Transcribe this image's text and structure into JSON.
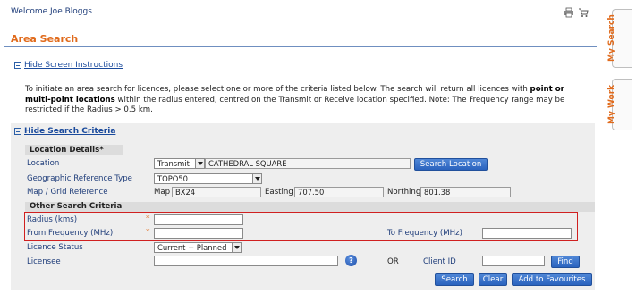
{
  "header": {
    "welcome": "Welcome Joe Bloggs",
    "page_title": "Area Search",
    "icons": [
      "print-icon",
      "shopping-cart-icon"
    ]
  },
  "instructions": {
    "toggle_label": "Hide Screen Instructions",
    "text_1": "To initiate an area search for licences, please select one or more of the criteria listed below. The search will return all licences with ",
    "bold_1": "point or",
    "bold_2": "multi-point locations",
    "text_2": " within the radius entered, centred on the Transmit or Receive location specified. Note: The Frequency range may be restricted if the Radius > 0.5 km."
  },
  "criteria": {
    "toggle_label": "Hide Search Criteria",
    "location_details": {
      "heading": "Location Details",
      "required_mark": "*",
      "location_label": "Location",
      "location_type": "Transmit",
      "location_value": "CATHEDRAL SQUARE",
      "search_location_button": "Search Location",
      "geo_ref_label": "Geographic Reference Type",
      "geo_ref_value": "TOPO50",
      "map_grid_label": "Map / Grid Reference",
      "map_label": "Map",
      "map_value": "BX24",
      "easting_label": "Easting",
      "easting_value": "707.50",
      "northing_label": "Northing",
      "northing_value": "801.38"
    },
    "other": {
      "heading": "Other Search Criteria",
      "radius_label": "Radius (kms)",
      "radius_value": "",
      "from_freq_label": "From Frequency (MHz)",
      "from_freq_value": "",
      "to_freq_label": "To Frequency (MHz)",
      "to_freq_value": "",
      "required_mark": "*",
      "licence_status_label": "Licence Status",
      "licence_status_value": "Current + Planned",
      "licensee_label": "Licensee",
      "licensee_value": "",
      "or_label": "OR",
      "client_id_label": "Client ID",
      "client_id_value": "",
      "find_button": "Find"
    }
  },
  "actions": {
    "search": "Search",
    "clear": "Clear",
    "add_to_favourites": "Add to Favourites"
  },
  "side_tabs": {
    "my_search": "My Search",
    "my_work": "My Work"
  },
  "colors": {
    "accent": "#e06a1b",
    "link": "#1a4a9c",
    "button": "#2a63be",
    "highlight": "#d02020"
  }
}
